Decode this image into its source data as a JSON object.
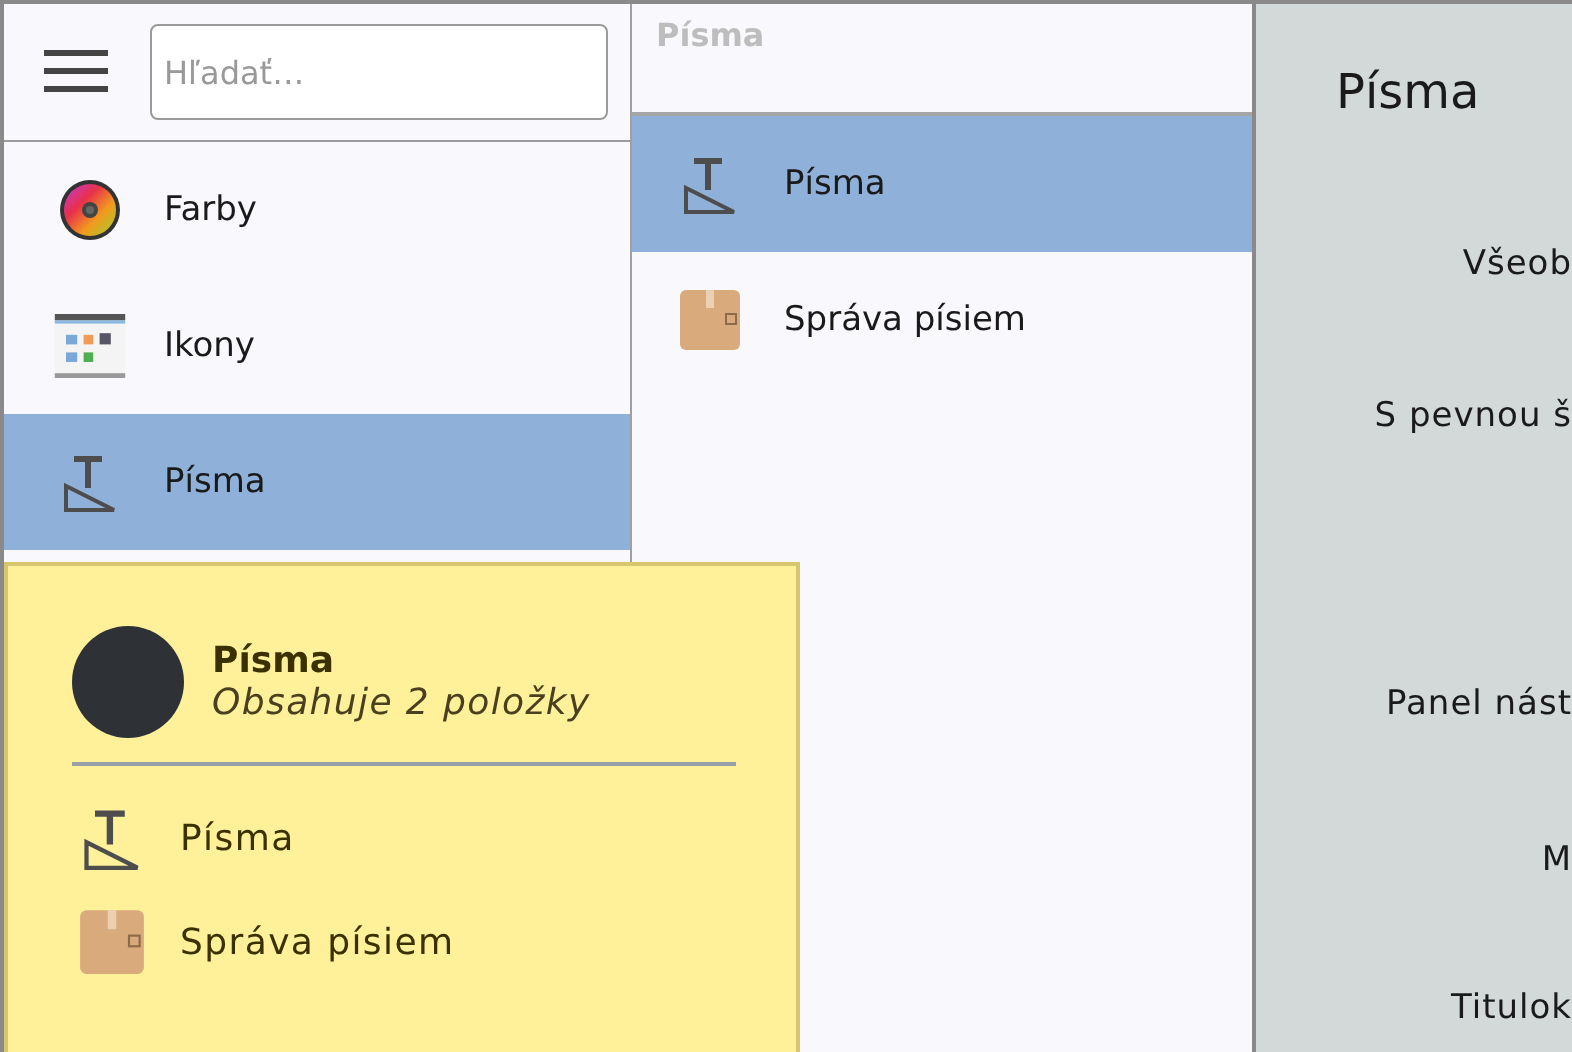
{
  "sidebar": {
    "search": {
      "placeholder": "Hľadať…"
    },
    "items": [
      {
        "label": "Farby",
        "kind": "colors",
        "selected": false
      },
      {
        "label": "Ikony",
        "kind": "icons",
        "selected": false
      },
      {
        "label": "Písma",
        "kind": "fonts",
        "selected": true
      }
    ]
  },
  "category": {
    "title": "Písma",
    "items": [
      {
        "label": "Písma",
        "kind": "fonts",
        "selected": true
      },
      {
        "label": "Správa písiem",
        "kind": "fontbox",
        "selected": false
      }
    ]
  },
  "page": {
    "title": "Písma",
    "labels": [
      "Všeob",
      "S pevnou š",
      "Panel nást",
      "M",
      "Titulok"
    ]
  },
  "tooltip": {
    "title": "Písma",
    "subtitle": "Obsahuje 2 položky",
    "items": [
      {
        "label": "Písma",
        "kind": "fonts"
      },
      {
        "label": "Správa písiem",
        "kind": "fontbox"
      }
    ]
  }
}
